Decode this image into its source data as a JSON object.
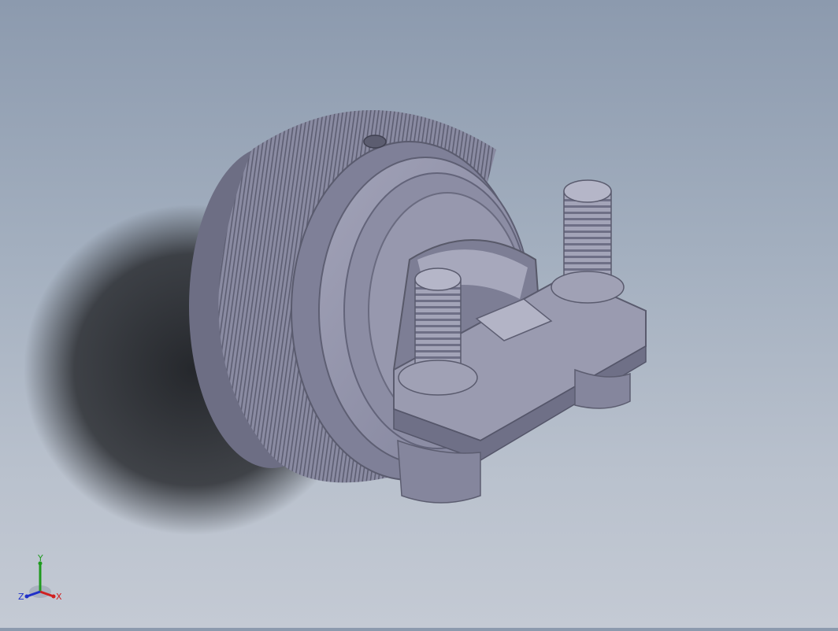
{
  "viewport": {
    "background_top": "#8c9aae",
    "background_bottom": "#c4cad4"
  },
  "model": {
    "body_color": "#8e8fa6",
    "shadow_color": "#2a2c30"
  },
  "triad": {
    "x_label": "X",
    "y_label": "Y",
    "z_label": "Z",
    "x_color": "#d02020",
    "y_color": "#1f9a1f",
    "z_color": "#2030c8"
  }
}
